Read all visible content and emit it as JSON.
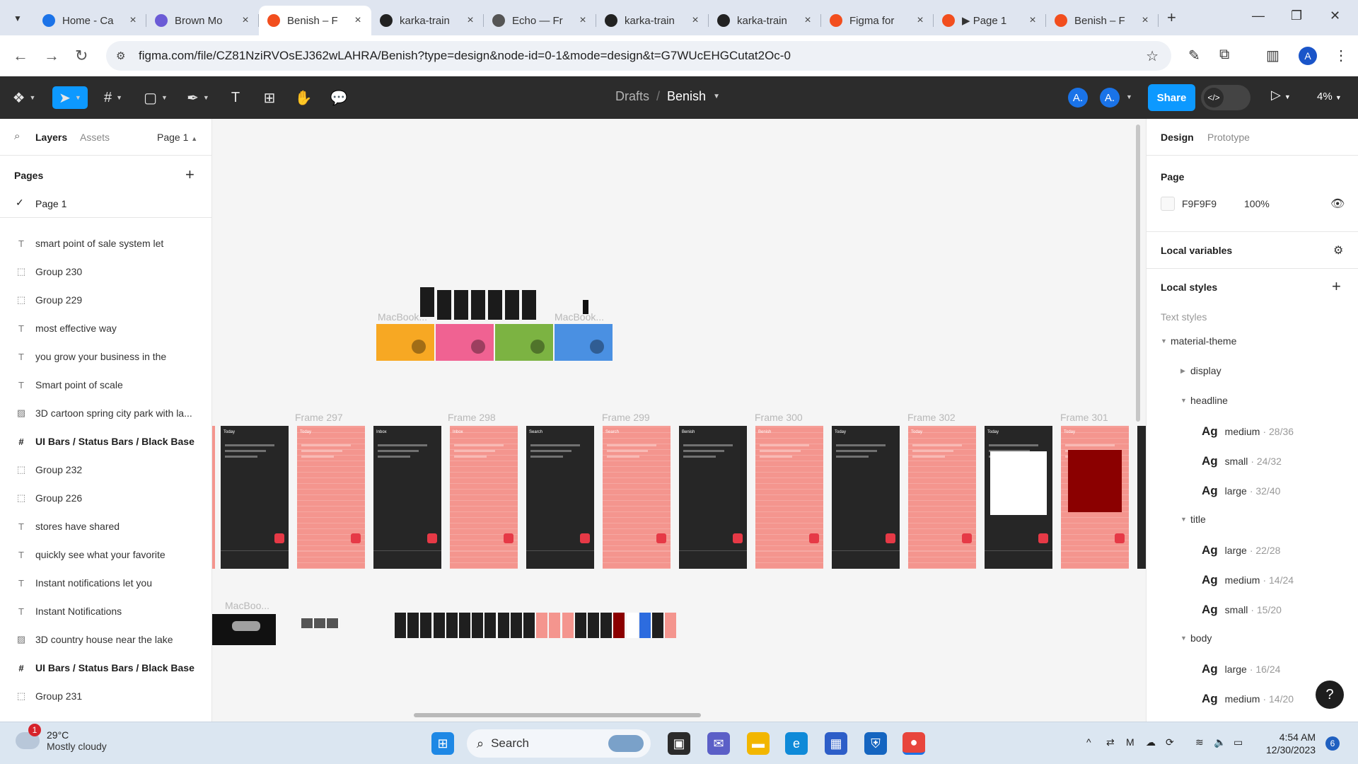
{
  "browser": {
    "tabs": [
      {
        "title": "Home - Ca",
        "favicon_color": "#1c73e8",
        "active": false
      },
      {
        "title": "Brown Mo",
        "favicon_color": "#6b5bd6",
        "active": false
      },
      {
        "title": "Benish – F",
        "favicon_color": "#f24e1e",
        "active": true
      },
      {
        "title": "karka-train",
        "favicon_color": "#222222",
        "active": false
      },
      {
        "title": "Echo — Fr",
        "favicon_color": "#555555",
        "active": false
      },
      {
        "title": "karka-train",
        "favicon_color": "#222222",
        "active": false
      },
      {
        "title": "karka-train",
        "favicon_color": "#222222",
        "active": false
      },
      {
        "title": "Figma for",
        "favicon_color": "#f24e1e",
        "active": false
      },
      {
        "title": "▶ Page 1",
        "favicon_color": "#f24e1e",
        "active": false
      },
      {
        "title": "Benish – F",
        "favicon_color": "#f24e1e",
        "active": false
      }
    ],
    "url": "figma.com/file/CZ81NziRVOsEJ362wLAHRA/Benish?type=design&node-id=0-1&mode=design&t=G7WUcEHGCutat2Oc-0",
    "profile_initial": "A"
  },
  "figma": {
    "breadcrumb_drafts": "Drafts",
    "breadcrumb_slash": "/",
    "file_name": "Benish",
    "avatar1": "A.",
    "avatar2": "A.",
    "share_label": "Share",
    "zoom": "4%",
    "accent_color": "#0d99ff"
  },
  "left_panel": {
    "tab_layers": "Layers",
    "tab_assets": "Assets",
    "page_selector": "Page 1",
    "pages_label": "Pages",
    "current_page": "Page 1",
    "layers": [
      {
        "icon": "text",
        "name": "smart point of sale system let",
        "bold": false
      },
      {
        "icon": "group",
        "name": "Group 230",
        "bold": false
      },
      {
        "icon": "group",
        "name": "Group 229",
        "bold": false
      },
      {
        "icon": "text",
        "name": "most effective way",
        "bold": false
      },
      {
        "icon": "text",
        "name": "you grow your business in the",
        "bold": false
      },
      {
        "icon": "text",
        "name": "Smart point of scale",
        "bold": false
      },
      {
        "icon": "image",
        "name": "3D cartoon spring city park with la...",
        "bold": false
      },
      {
        "icon": "frame",
        "name": "UI Bars / Status Bars / Black Base",
        "bold": true
      },
      {
        "icon": "group",
        "name": "Group 232",
        "bold": false
      },
      {
        "icon": "group",
        "name": "Group 226",
        "bold": false
      },
      {
        "icon": "text",
        "name": "stores have shared",
        "bold": false
      },
      {
        "icon": "text",
        "name": "quickly see what your favorite",
        "bold": false
      },
      {
        "icon": "text",
        "name": "Instant notifications let you",
        "bold": false
      },
      {
        "icon": "text",
        "name": "Instant Notifications",
        "bold": false
      },
      {
        "icon": "image",
        "name": "3D country house near the lake",
        "bold": false
      },
      {
        "icon": "frame",
        "name": "UI Bars / Status Bars / Black Base",
        "bold": true
      },
      {
        "icon": "group",
        "name": "Group 231",
        "bold": false
      }
    ]
  },
  "canvas": {
    "macbook_label_1": "MacBook...",
    "macbook_label_2": "MacBook...",
    "macbook_label_3": "MacBoo...",
    "frame_labels": [
      "Frame 297",
      "Frame 298",
      "Frame 299",
      "Frame 300",
      "Frame 302",
      "Frame 301"
    ],
    "frames": [
      {
        "theme": "dark",
        "header": "Today"
      },
      {
        "theme": "pink",
        "header": "Today"
      },
      {
        "theme": "dark",
        "header": "Inbox"
      },
      {
        "theme": "pink",
        "header": "Inbox"
      },
      {
        "theme": "dark",
        "header": "Search"
      },
      {
        "theme": "pink",
        "header": "Search"
      },
      {
        "theme": "dark",
        "header": "Benish"
      },
      {
        "theme": "pink",
        "header": "Benish"
      },
      {
        "theme": "dark",
        "header": "Today"
      },
      {
        "theme": "pink",
        "header": "Today"
      },
      {
        "theme": "dark",
        "header": "Today"
      },
      {
        "theme": "pink",
        "header": "Today"
      }
    ],
    "promo_colors": [
      "#f7a823",
      "#f06292",
      "#7cb342",
      "#4a90e2"
    ]
  },
  "right_panel": {
    "tab_design": "Design",
    "tab_prototype": "Prototype",
    "page_label": "Page",
    "page_color": "F9F9F9",
    "page_opacity": "100%",
    "local_variables": "Local variables",
    "local_styles": "Local styles",
    "text_styles": "Text styles",
    "groups": [
      {
        "name": "material-theme",
        "level": 0,
        "expanded": true
      },
      {
        "name": "display",
        "level": 1,
        "expanded": false
      },
      {
        "name": "headline",
        "level": 1,
        "expanded": true
      }
    ],
    "styles": [
      {
        "section": "headline",
        "size": "medium",
        "meta": "· 28/36"
      },
      {
        "section": "headline",
        "size": "small",
        "meta": "· 24/32"
      },
      {
        "section": "headline",
        "size": "large",
        "meta": "· 32/40"
      },
      {
        "section": "title",
        "size": "large",
        "meta": "· 22/28"
      },
      {
        "section": "title",
        "size": "medium",
        "meta": "· 14/24"
      },
      {
        "section": "title",
        "size": "small",
        "meta": "· 15/20"
      },
      {
        "section": "body",
        "size": "large",
        "meta": "· 16/24"
      },
      {
        "section": "body",
        "size": "medium",
        "meta": "· 14/20"
      }
    ],
    "title_group": "title",
    "body_group": "body",
    "ag": "Ag"
  },
  "taskbar": {
    "temp": "29°C",
    "weather": "Mostly cloudy",
    "weather_badge": "1",
    "search": "Search",
    "time": "4:54 AM",
    "date": "12/30/2023",
    "notifications": "6"
  }
}
